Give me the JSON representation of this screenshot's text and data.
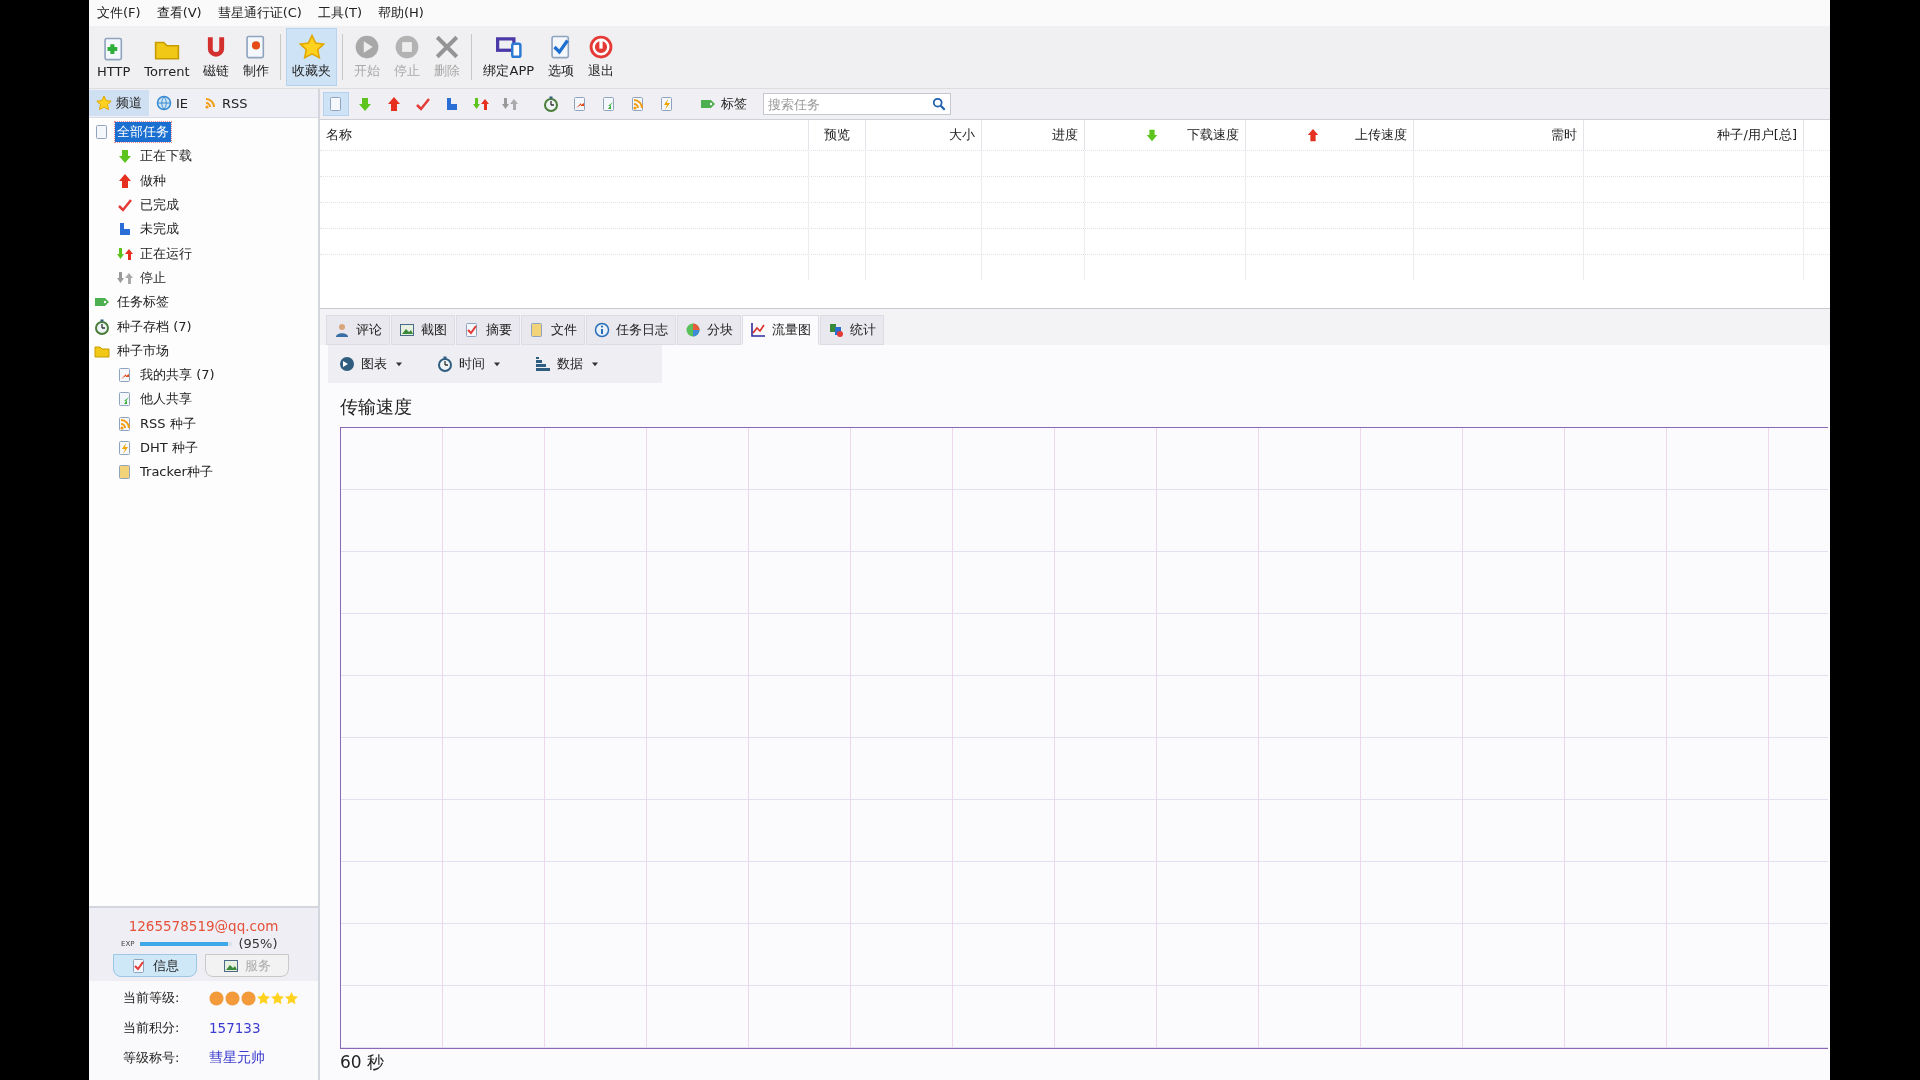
{
  "menu": [
    "文件(F)",
    "查看(V)",
    "彗星通行证(C)",
    "工具(T)",
    "帮助(H)"
  ],
  "toolbar": [
    {
      "label": "HTTP",
      "disabled": false,
      "selected": false
    },
    {
      "label": "Torrent",
      "disabled": false,
      "selected": false
    },
    {
      "label": "磁链",
      "disabled": false,
      "selected": false
    },
    {
      "label": "制作",
      "disabled": false,
      "selected": false
    },
    {
      "label": "收藏夹",
      "disabled": false,
      "selected": true
    },
    {
      "label": "开始",
      "disabled": true,
      "selected": false
    },
    {
      "label": "停止",
      "disabled": true,
      "selected": false
    },
    {
      "label": "删除",
      "disabled": true,
      "selected": false
    },
    {
      "label": "绑定APP",
      "disabled": false,
      "selected": false
    },
    {
      "label": "选项",
      "disabled": false,
      "selected": false
    },
    {
      "label": "退出",
      "disabled": false,
      "selected": false
    }
  ],
  "sidebar_tabs": [
    {
      "label": "频道",
      "selected": true
    },
    {
      "label": "IE",
      "selected": false
    },
    {
      "label": "RSS",
      "selected": false
    }
  ],
  "tree": [
    {
      "label": "全部任务",
      "selected": true,
      "children": [
        {
          "label": "正在下载",
          "selected": false
        },
        {
          "label": "做种",
          "selected": false
        },
        {
          "label": "已完成",
          "selected": false
        },
        {
          "label": "未完成",
          "selected": false
        },
        {
          "label": "正在运行",
          "selected": false
        },
        {
          "label": "停止",
          "selected": false
        }
      ]
    },
    {
      "label": "任务标签",
      "selected": false
    },
    {
      "label": "种子存档 (7)",
      "selected": false
    },
    {
      "label": "种子市场",
      "selected": false,
      "children": [
        {
          "label": "我的共享 (7)",
          "selected": false
        },
        {
          "label": "他人共享",
          "selected": false
        },
        {
          "label": "RSS 种子",
          "selected": false
        },
        {
          "label": "DHT 种子",
          "selected": false
        },
        {
          "label": "Tracker种子",
          "selected": false
        }
      ]
    }
  ],
  "task_toolbar": {
    "icon_buttons": [
      {
        "selected": true
      },
      {
        "selected": false
      },
      {
        "selected": false
      },
      {
        "selected": false
      },
      {
        "selected": false
      },
      {
        "selected": false
      },
      {
        "selected": false
      },
      {
        "selected": false
      },
      {
        "selected": false
      },
      {
        "selected": false
      },
      {
        "selected": false
      },
      {
        "selected": false
      }
    ],
    "tag_label": "标签",
    "search": {
      "placeholder": "搜索任务"
    }
  },
  "table": {
    "columns": [
      "名称",
      "预览",
      "大小",
      "进度",
      "下载速度",
      "上传速度",
      "需时",
      "种子/用户[总]"
    ]
  },
  "detail_tabs": [
    {
      "label": "评论",
      "selected": false
    },
    {
      "label": "截图",
      "selected": false
    },
    {
      "label": "摘要",
      "selected": false
    },
    {
      "label": "文件",
      "selected": false
    },
    {
      "label": "任务日志",
      "selected": false
    },
    {
      "label": "分块",
      "selected": false
    },
    {
      "label": "流量图",
      "selected": true
    },
    {
      "label": "统计",
      "selected": false
    }
  ],
  "chart_toolbar": [
    "图表",
    "时间",
    "数据"
  ],
  "chart": {
    "title": "传输速度",
    "x_caption": "60 秒"
  },
  "account": {
    "email": "1265578519@qq.com",
    "exp_label": "EXP",
    "level": 0.95,
    "exp_reading": "(95%)",
    "buttons": [
      {
        "label": "信息",
        "selected": true
      },
      {
        "label": "服务",
        "selected": false
      }
    ],
    "rows": [
      {
        "label": "当前等级:",
        "kind": "rank"
      },
      {
        "label": "当前积分:",
        "kind": "text",
        "value": "157133"
      },
      {
        "label": "等级称号:",
        "kind": "text",
        "value": "彗星元帅"
      }
    ]
  }
}
